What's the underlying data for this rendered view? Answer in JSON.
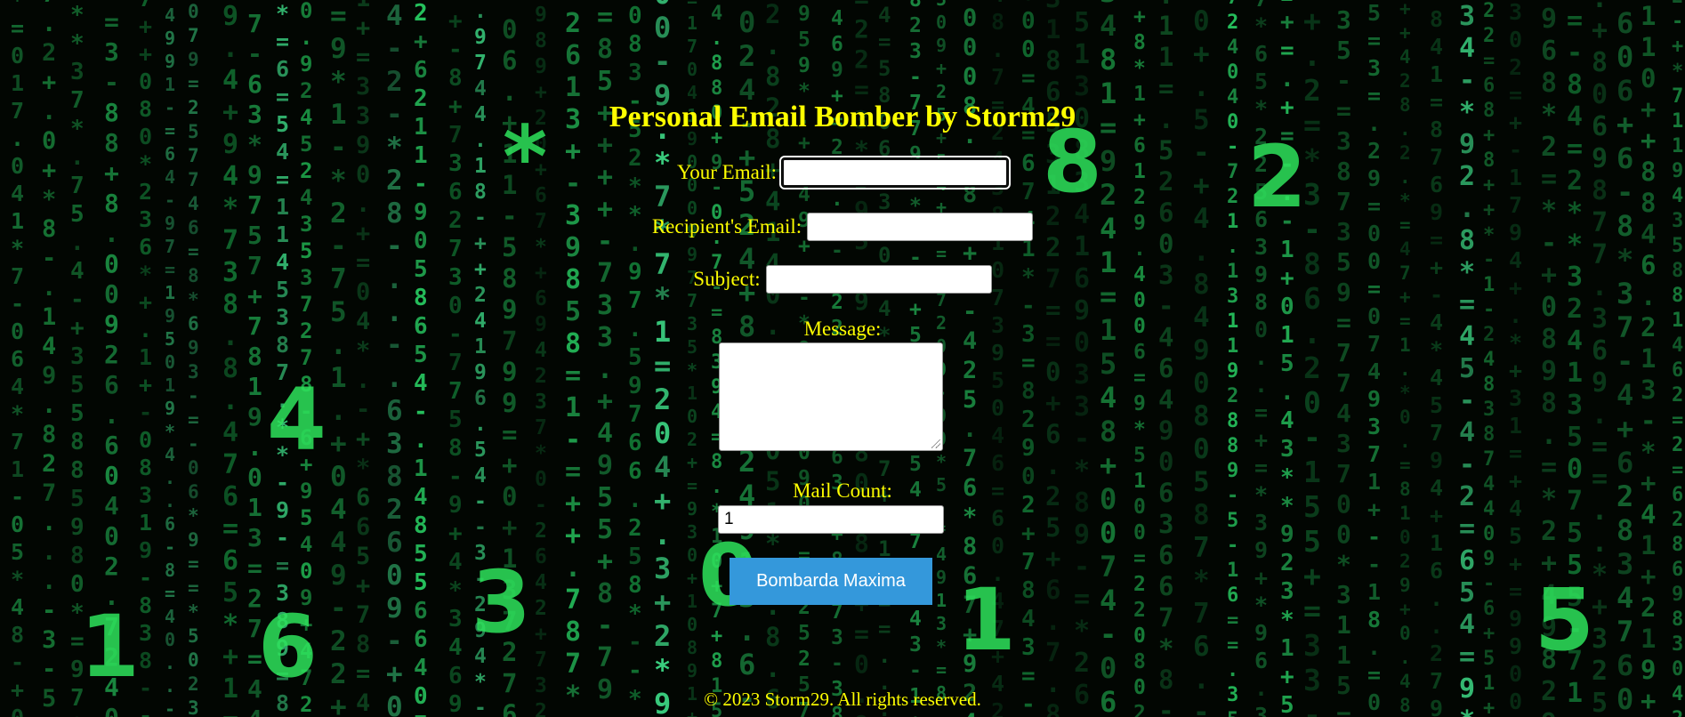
{
  "page": {
    "title": "Personal Email Bomber by Storm29",
    "accent_color": "#ffff00",
    "background": "matrix-digital-rain"
  },
  "form": {
    "your_email_label": "Your Email:",
    "your_email_value": "",
    "recipient_email_label": "Recipient's Email:",
    "recipient_email_value": "",
    "subject_label": "Subject:",
    "subject_value": "",
    "message_label": "Message:",
    "message_value": "",
    "mail_count_label": "Mail Count:",
    "mail_count_value": "1",
    "submit_label": "Bombarda Maxima",
    "submit_color": "#3498db"
  },
  "footer": {
    "text": "© 2023 Storm29. All rights reserved."
  }
}
